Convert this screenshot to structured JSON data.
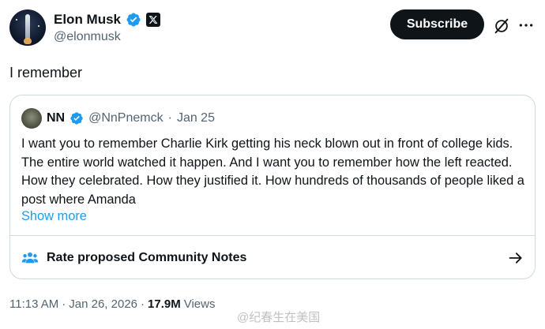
{
  "author": {
    "display_name": "Elon Musk",
    "handle": "@elonmusk"
  },
  "actions": {
    "subscribe_label": "Subscribe"
  },
  "tweet": {
    "text": "I remember",
    "time": "11:13 AM",
    "separator1": "·",
    "date": "Jan 26, 2026",
    "separator2": "·",
    "views_count": "17.9M",
    "views_label": "Views"
  },
  "quote": {
    "display_name": "NN",
    "handle": "@NnPnemck",
    "separator": "·",
    "date": "Jan 25",
    "text": "I want you to remember Charlie Kirk getting his neck blown out in front of college kids. The entire world watched it happen. And I want you to remember how the left reacted. How they celebrated. How they justified it. How hundreds of thousands of people liked a post where Amanda",
    "show_more": "Show more"
  },
  "community_notes": {
    "label": "Rate proposed Community Notes"
  },
  "watermark": {
    "text": "@纪春生在美国"
  },
  "icons": {
    "verified": "verified-badge-icon",
    "x_logo": "x-logo-icon",
    "grok": "grok-icon",
    "more": "more-icon",
    "notes": "people-icon",
    "arrow": "arrow-right-icon"
  },
  "colors": {
    "verified_blue": "#1d9bf0",
    "text_primary": "#0f1419",
    "text_secondary": "#536471",
    "border": "#cfd9de"
  }
}
